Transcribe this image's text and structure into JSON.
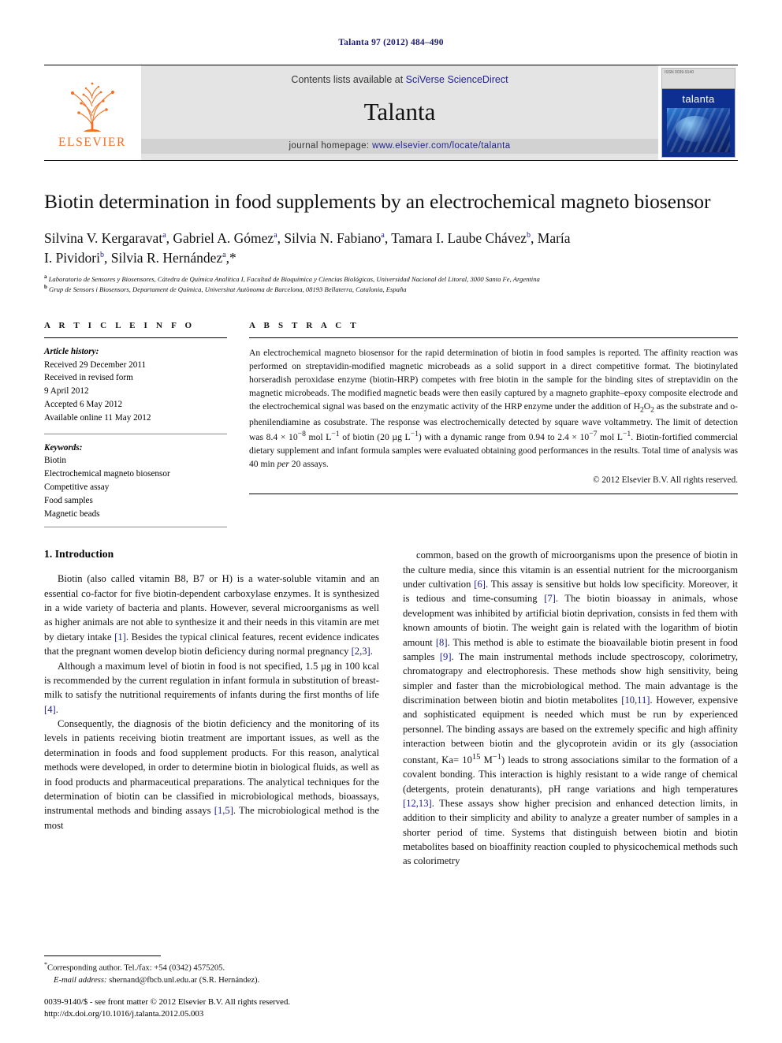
{
  "running_head": "Talanta 97 (2012) 484–490",
  "masthead": {
    "publisher_name": "ELSEVIER",
    "contents_prefix": "Contents lists available at ",
    "contents_link": "SciVerse ScienceDirect",
    "journal_name": "Talanta",
    "homepage_prefix": "journal homepage: ",
    "homepage_url": "www.elsevier.com/locate/talanta",
    "cover_header": "ISSN 0039-9140",
    "cover_title": "talanta"
  },
  "article": {
    "title": "Biotin determination in food supplements by an electrochemical magneto biosensor",
    "authors_line_1": "Silvina V. Kergaravat a, Gabriel A. Gómez a, Silvia N. Fabiano a, Tamara I. Laube Chávez b, María",
    "authors_line_2": "I. Pividori b, Silvia R. Hernández a,*",
    "affiliation_a": "Laboratorio de Sensores y Biosensores, Cátedra de Química Analítica I, Facultad de Bioquímica y Ciencias Biológicas, Universidad Nacional del Litoral, 3000 Santa Fe, Argentina",
    "affiliation_b": "Grup de Sensors i Biosensors, Departament de Química, Universitat Autònoma de Barcelona, 08193 Bellaterra, Catalonia, España"
  },
  "article_info": {
    "heading": "A R T I C L E  I N F O",
    "history_label": "Article history:",
    "history": [
      "Received 29 December 2011",
      "Received in revised form",
      "9 April 2012",
      "Accepted 6 May 2012",
      "Available online 11 May 2012"
    ],
    "keywords_label": "Keywords:",
    "keywords": [
      "Biotin",
      "Electrochemical magneto biosensor",
      "Competitive assay",
      "Food samples",
      "Magnetic beads"
    ]
  },
  "abstract": {
    "heading": "A B S T R A C T",
    "text": "An electrochemical magneto biosensor for the rapid determination of biotin in food samples is reported. The affinity reaction was performed on streptavidin-modified magnetic microbeads as a solid support in a direct competitive format. The biotinylated horseradish peroxidase enzyme (biotin-HRP) competes with free biotin in the sample for the binding sites of streptavidin on the magnetic microbeads. The modified magnetic beads were then easily captured by a magneto graphite–epoxy composite electrode and the electrochemical signal was based on the enzymatic activity of the HRP enzyme under the addition of H2O2 as the substrate and o-phenilendiamine as cosubstrate. The response was electrochemically detected by square wave voltammetry. The limit of detection was 8.4 × 10−8 mol L−1 of biotin (20 µg L−1) with a dynamic range from 0.94 to 2.4 × 10−7 mol L−1. Biotin-fortified commercial dietary supplement and infant formula samples were evaluated obtaining good performances in the results. Total time of analysis was 40 min per 20 assays.",
    "copyright": "© 2012 Elsevier B.V. All rights reserved."
  },
  "introduction": {
    "heading": "1. Introduction",
    "left_paragraphs": [
      "Biotin (also called vitamin B8, B7 or H) is a water-soluble vitamin and an essential co-factor for five biotin-dependent carboxylase enzymes. It is synthesized in a wide variety of bacteria and plants. However, several microorganisms as well as higher animals are not able to synthesize it and their needs in this vitamin are met by dietary intake [1]. Besides the typical clinical features, recent evidence indicates that the pregnant women develop biotin deficiency during normal pregnancy [2,3].",
      "Although a maximum level of biotin in food is not specified, 1.5 µg in 100 kcal is recommended by the current regulation in infant formula in substitution of breast-milk to satisfy the nutritional requirements of infants during the first months of life [4].",
      "Consequently, the diagnosis of the biotin deficiency and the monitoring of its levels in patients receiving biotin treatment are important issues, as well as the determination in foods and food supplement products. For this reason, analytical methods were developed, in order to determine biotin in biological fluids, as well as in food products and pharmaceutical preparations. The analytical techniques for the determination of biotin can be classified in microbiological methods, bioassays, instrumental methods and binding assays [1,5]. The microbiological method is the most"
    ],
    "right_paragraphs": [
      "common, based on the growth of microorganisms upon the presence of biotin in the culture media, since this vitamin is an essential nutrient for the microorganism under cultivation [6]. This assay is sensitive but holds low specificity. Moreover, it is tedious and time-consuming [7]. The biotin bioassay in animals, whose development was inhibited by artificial biotin deprivation, consists in fed them with known amounts of biotin. The weight gain is related with the logarithm of biotin amount [8]. This method is able to estimate the bioavailable biotin present in food samples [9]. The main instrumental methods include spectroscopy, colorimetry, chromatograpy and electrophoresis. These methods show high sensitivity, being simpler and faster than the microbiological method. The main advantage is the discrimination between biotin and biotin metabolites [10,11]. However, expensive and sophisticated equipment is needed which must be run by experienced personnel. The binding assays are based on the extremely specific and high affinity interaction between biotin and the glycoprotein avidin or its gly (association constant, Ka= 1015 M−1) leads to strong associations similar to the formation of a covalent bonding. This interaction is highly resistant to a wide range of chemical (detergents, protein denaturants), pH range variations and high temperatures [12,13]. These assays show higher precision and enhanced detection limits, in addition to their simplicity and ability to analyze a greater number of samples in a shorter period of time. Systems that distinguish between biotin and biotin metabolites based on bioaffinity reaction coupled to physicochemical methods such as colorimetry"
    ]
  },
  "footnotes": {
    "corresponding": "Corresponding author. Tel./fax: +54 (0342) 4575205.",
    "email_label": "E-mail address:",
    "email": "shernand@fbcb.unl.edu.ar (S.R. Hernández).",
    "issn_line": "0039-9140/$ - see front matter © 2012 Elsevier B.V. All rights reserved.",
    "doi_line": "http://dx.doi.org/10.1016/j.talanta.2012.05.003"
  },
  "colors": {
    "link_blue": "#24248f",
    "reference_blue": "#1a1a8c",
    "elsevier_orange": "#f37021",
    "masthead_grey": "#e4e4e4"
  }
}
